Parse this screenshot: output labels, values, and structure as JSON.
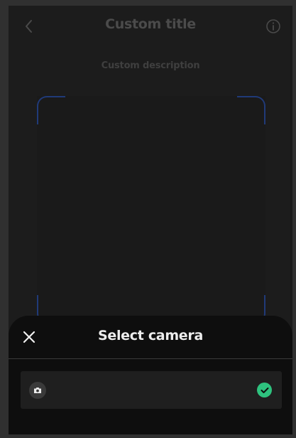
{
  "header": {
    "title": "Custom title",
    "back_icon": "chevron-left-icon",
    "info_icon": "info-icon"
  },
  "description": "Custom description",
  "sheet": {
    "title": "Select camera",
    "close_icon": "close-icon",
    "cameras": [
      {
        "label": "",
        "icon": "camera-icon",
        "selected": true,
        "selected_icon": "check-circle-icon"
      }
    ]
  },
  "colors": {
    "accent_check": "#2ec27e",
    "scan_corner": "#203a78",
    "sheet_bg": "#0e0e0e",
    "page_bg": "#1c1c1c"
  }
}
